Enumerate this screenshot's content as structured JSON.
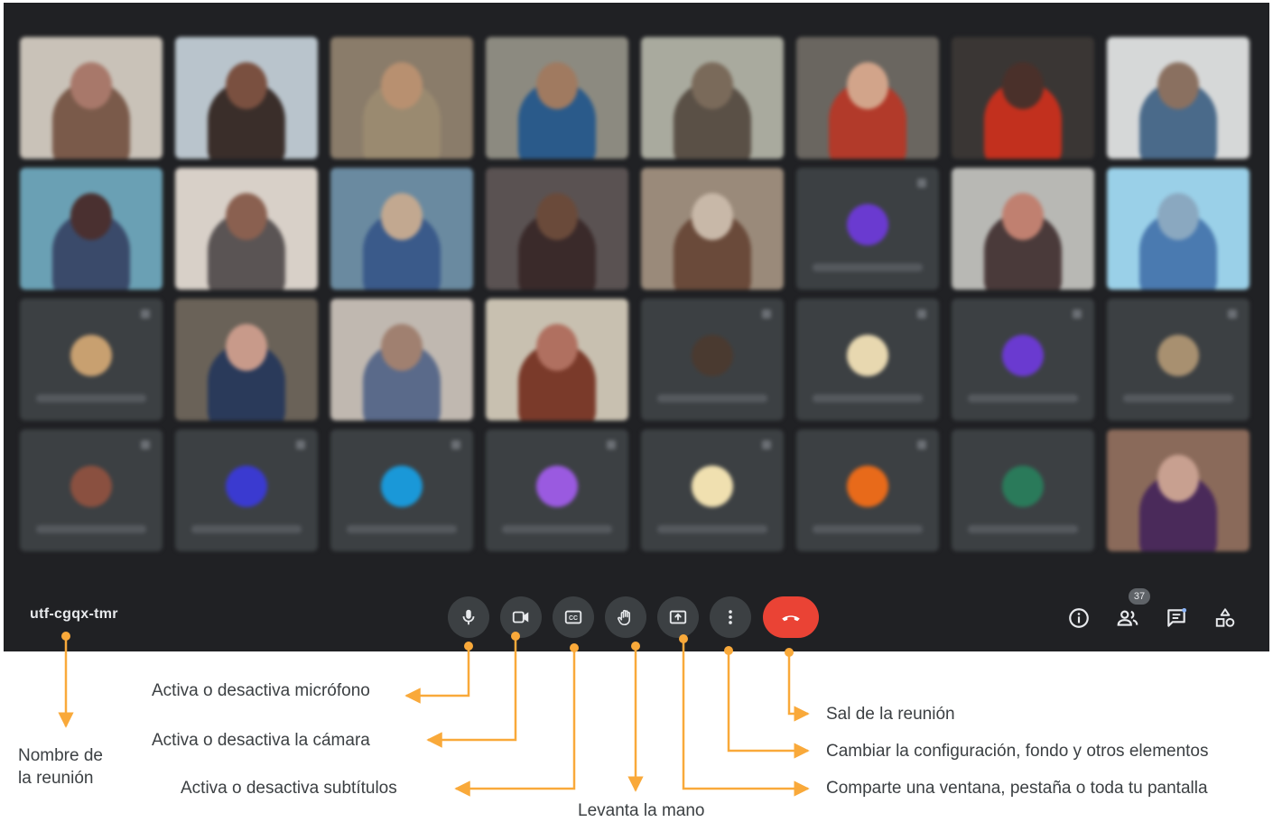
{
  "meeting": {
    "code": "utf-cgqx-tmr",
    "participant_count": "37"
  },
  "controls": [
    {
      "id": "mic",
      "icon": "microphone-icon"
    },
    {
      "id": "camera",
      "icon": "video-camera-icon"
    },
    {
      "id": "captions",
      "icon": "closed-captions-icon"
    },
    {
      "id": "raise-hand",
      "icon": "hand-icon"
    },
    {
      "id": "present",
      "icon": "present-screen-icon"
    },
    {
      "id": "more",
      "icon": "more-vert-icon"
    },
    {
      "id": "end-call",
      "icon": "phone-hangup-icon"
    }
  ],
  "right_controls": [
    {
      "id": "info",
      "icon": "info-icon"
    },
    {
      "id": "people",
      "icon": "people-icon"
    },
    {
      "id": "chat",
      "icon": "chat-icon"
    },
    {
      "id": "activities",
      "icon": "activities-icon"
    }
  ],
  "annotations": {
    "meeting_name": "Nombre de\nla reunión",
    "mic": "Activa o desactiva micrófono",
    "camera": "Activa o desactiva la cámara",
    "captions": "Activa o desactiva subtítulos",
    "raise_hand": "Levanta la mano",
    "leave": "Sal de la reunión",
    "settings": "Cambiar la configuración, fondo y otros elementos",
    "present": "Comparte una ventana, pestaña o toda tu pantalla"
  },
  "colors": {
    "background": "#202124",
    "button": "#3c4043",
    "end_call": "#ea4335",
    "annotation_arrow": "#f9a93a",
    "annotation_text": "#3c4043"
  }
}
